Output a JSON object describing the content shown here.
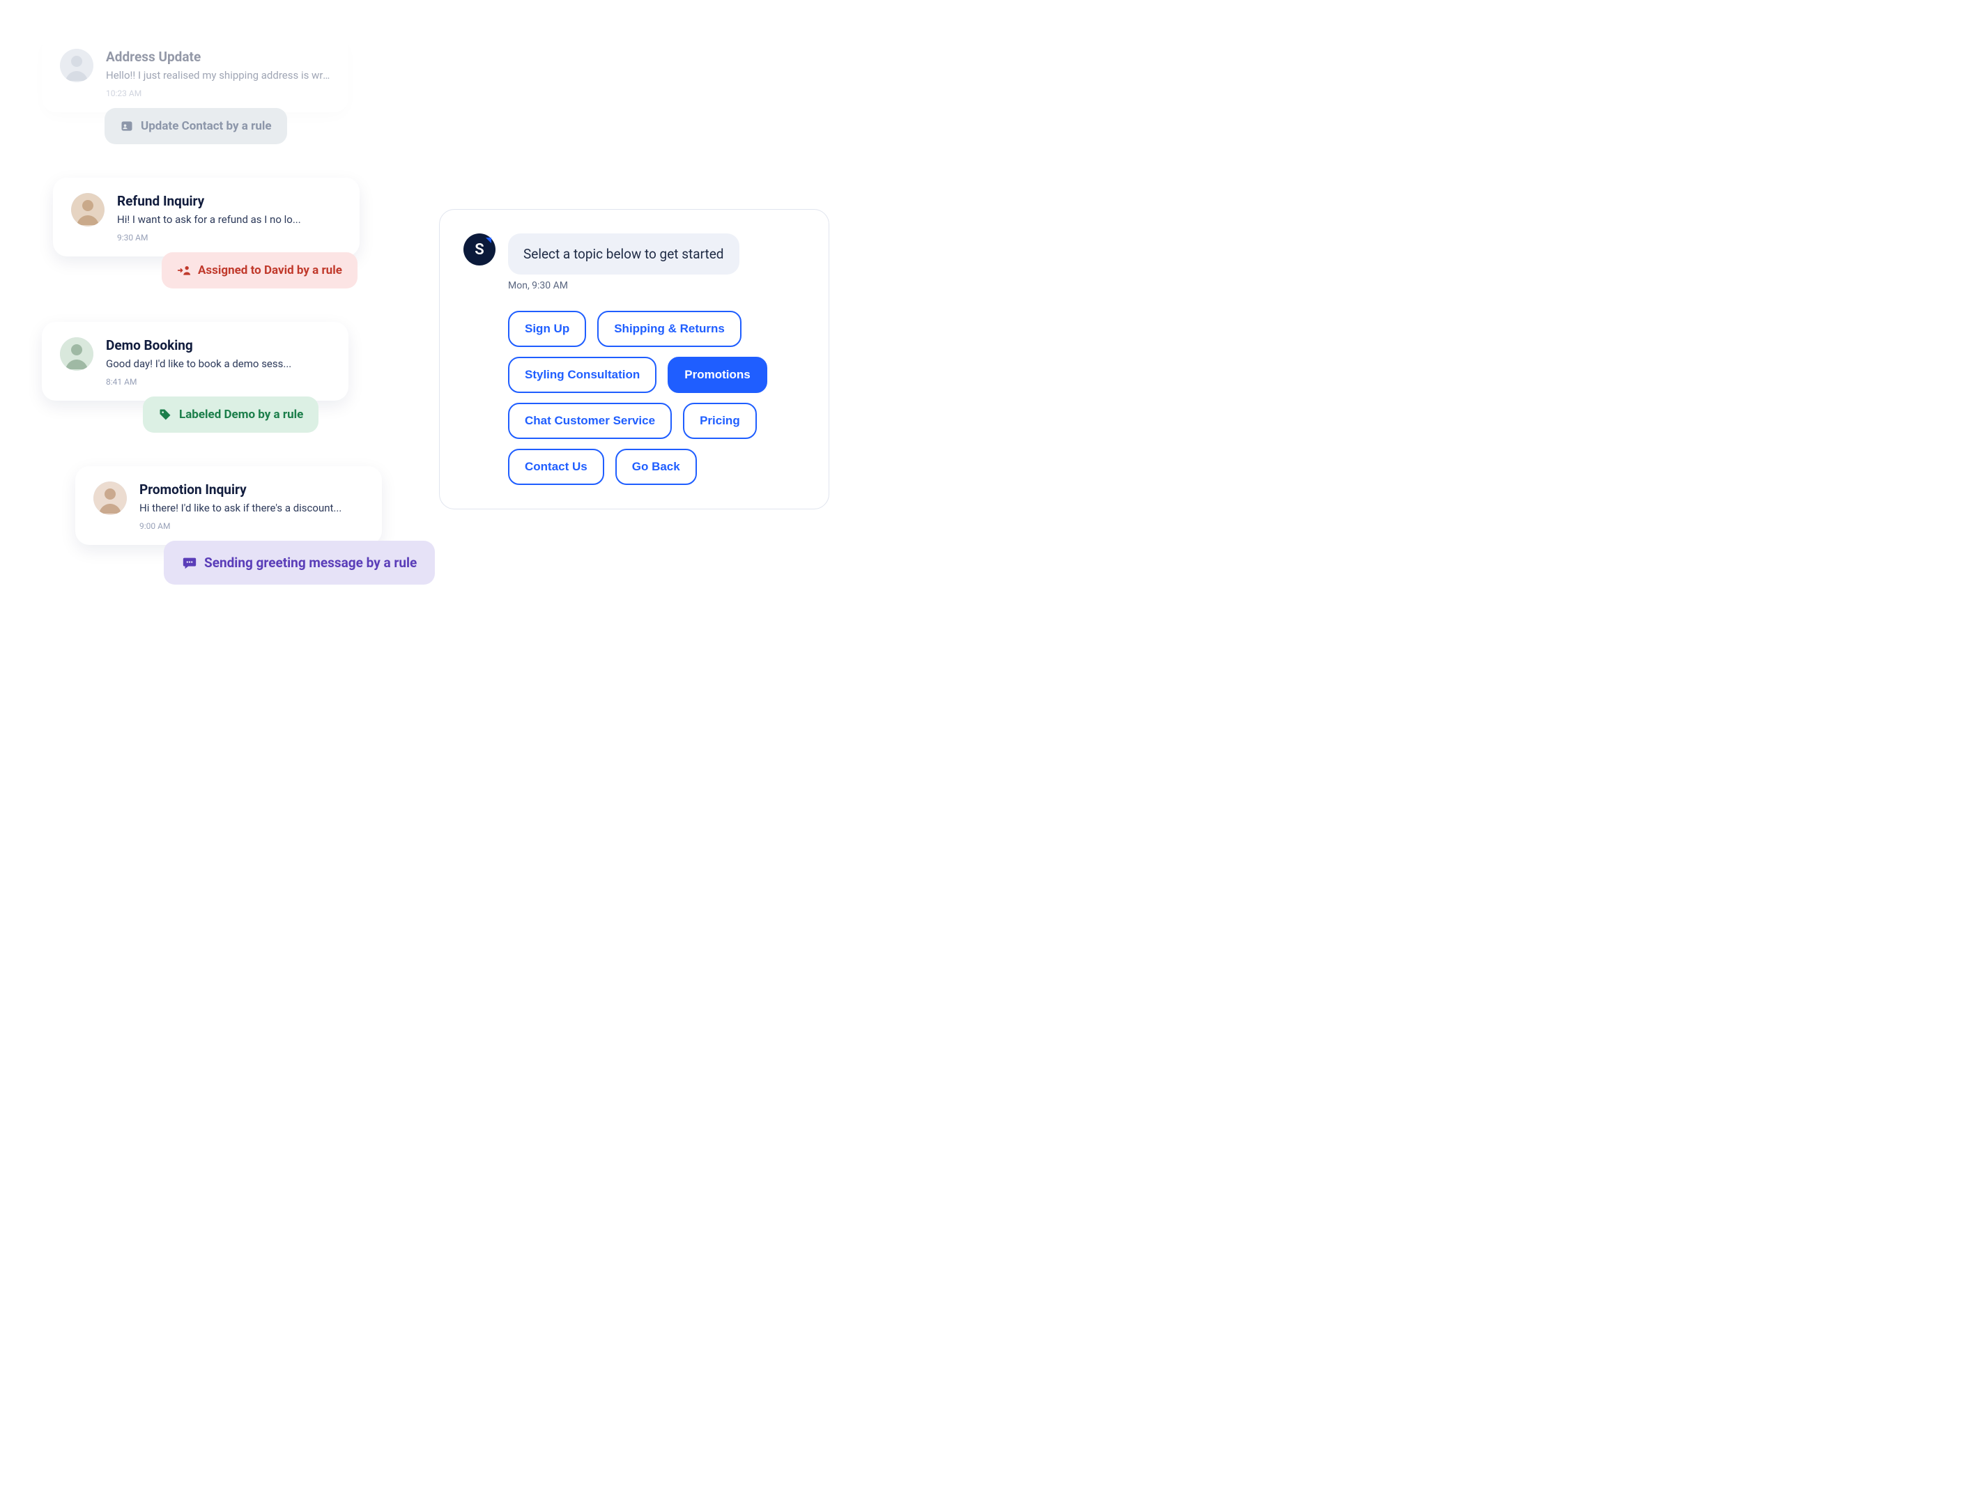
{
  "colors": {
    "accent_blue": "#1f5eff",
    "pill_red_bg": "#fce4e4",
    "pill_red_fg": "#c0392b",
    "pill_green_bg": "#dcf0e4",
    "pill_green_fg": "#1b7e4a",
    "pill_purple_bg": "#e6e2f7",
    "pill_purple_fg": "#5a3db8",
    "pill_gray_bg": "#e8ecef",
    "pill_gray_fg": "#8c96a9"
  },
  "conversations": [
    {
      "title": "Address Update",
      "preview": "Hello!! I just realised my shipping address is wrong...",
      "time": "10:23 AM",
      "rule_label": "Update Contact by a rule",
      "rule_icon": "contact-card-icon",
      "faded": true
    },
    {
      "title": "Refund Inquiry",
      "preview": "Hi! I want to ask for a refund as I no lo...",
      "time": "9:30 AM",
      "rule_label": "Assigned to David by a rule",
      "rule_icon": "assign-user-icon"
    },
    {
      "title": "Demo Booking",
      "preview": "Good day! I'd like to book a demo sess...",
      "time": "8:41 AM",
      "rule_label": "Labeled Demo by a rule",
      "rule_icon": "tag-icon"
    },
    {
      "title": "Promotion Inquiry",
      "preview": "Hi there! I'd like to ask if there's a discount...",
      "time": "9:00 AM",
      "rule_label": "Sending greeting message by a rule",
      "rule_icon": "chat-bubble-icon"
    }
  ],
  "bot": {
    "avatar_letter": "S",
    "message": "Select a topic below to get started",
    "time": "Mon, 9:30 AM",
    "topics": [
      {
        "label": "Sign Up",
        "active": false
      },
      {
        "label": "Shipping & Returns",
        "active": false
      },
      {
        "label": "Styling Consultation",
        "active": false
      },
      {
        "label": "Promotions",
        "active": true
      },
      {
        "label": "Chat Customer Service",
        "active": false
      },
      {
        "label": "Pricing",
        "active": false
      },
      {
        "label": "Contact Us",
        "active": false
      },
      {
        "label": "Go Back",
        "active": false
      }
    ]
  }
}
